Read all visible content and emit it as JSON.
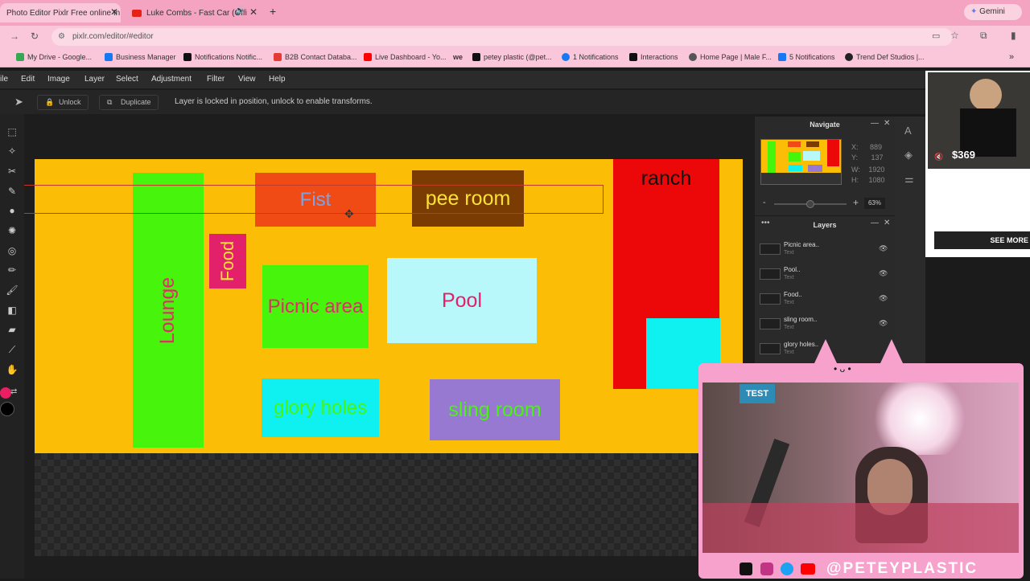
{
  "browser": {
    "tabs": [
      {
        "label": "Photo Editor Pixlr Free online In",
        "active": true
      },
      {
        "label": "Luke Combs - Fast Car (Offi",
        "active": false
      }
    ],
    "new_tab": "+",
    "gemini": "Gemini",
    "url": "pixlr.com/editor/#editor",
    "bookmarks": [
      "My Drive - Google...",
      "Business Manager",
      "Notifications Notific...",
      "B2B Contact Databa...",
      "Live Dashboard - Yo...",
      "petey plastic (@pet...",
      "1 Notifications",
      "Interactions",
      "Home Page | Male F...",
      "5 Notifications",
      "Trend Def Studios |..."
    ]
  },
  "editor": {
    "menu": [
      "ile",
      "Edit",
      "Image",
      "Layer",
      "Select",
      "Adjustment",
      "Filter",
      "View",
      "Help"
    ],
    "unlock": "Unlock",
    "duplicate": "Duplicate",
    "lock_message": "Layer is locked in position, unlock to enable transforms.",
    "rooms": {
      "fist": "Fist",
      "pee_room": "pee room",
      "ranch": "ranch",
      "food": "Food",
      "lounge": "Lounge",
      "picnic": "Picnic area",
      "pool": "Pool",
      "glory": "glory holes",
      "sling": "sling room"
    },
    "navigate": {
      "title": "Navigate",
      "x_label": "X:",
      "x": "889",
      "y_label": "Y:",
      "y": "137",
      "w_label": "W:",
      "w": "1920",
      "h_label": "H:",
      "h": "1080",
      "zoom": "63%",
      "minus": "-",
      "plus": "+"
    },
    "layers": {
      "title": "Layers",
      "items": [
        {
          "name": "Picnic area..",
          "type": "Text"
        },
        {
          "name": "Pool..",
          "type": "Text"
        },
        {
          "name": "Food..",
          "type": "Text"
        },
        {
          "name": "sling room..",
          "type": "Text"
        },
        {
          "name": "glory holes..",
          "type": "Text"
        }
      ]
    }
  },
  "ad": {
    "price": "$369",
    "cta": "SEE MORE"
  },
  "stream": {
    "handle": "@PETEYPLASTIC",
    "cam_text": "TEST"
  },
  "colors": {
    "canvas_bg": "#fbbd06",
    "tab_bar": "#f4a3c1",
    "overlay": "#f7a1cd"
  }
}
